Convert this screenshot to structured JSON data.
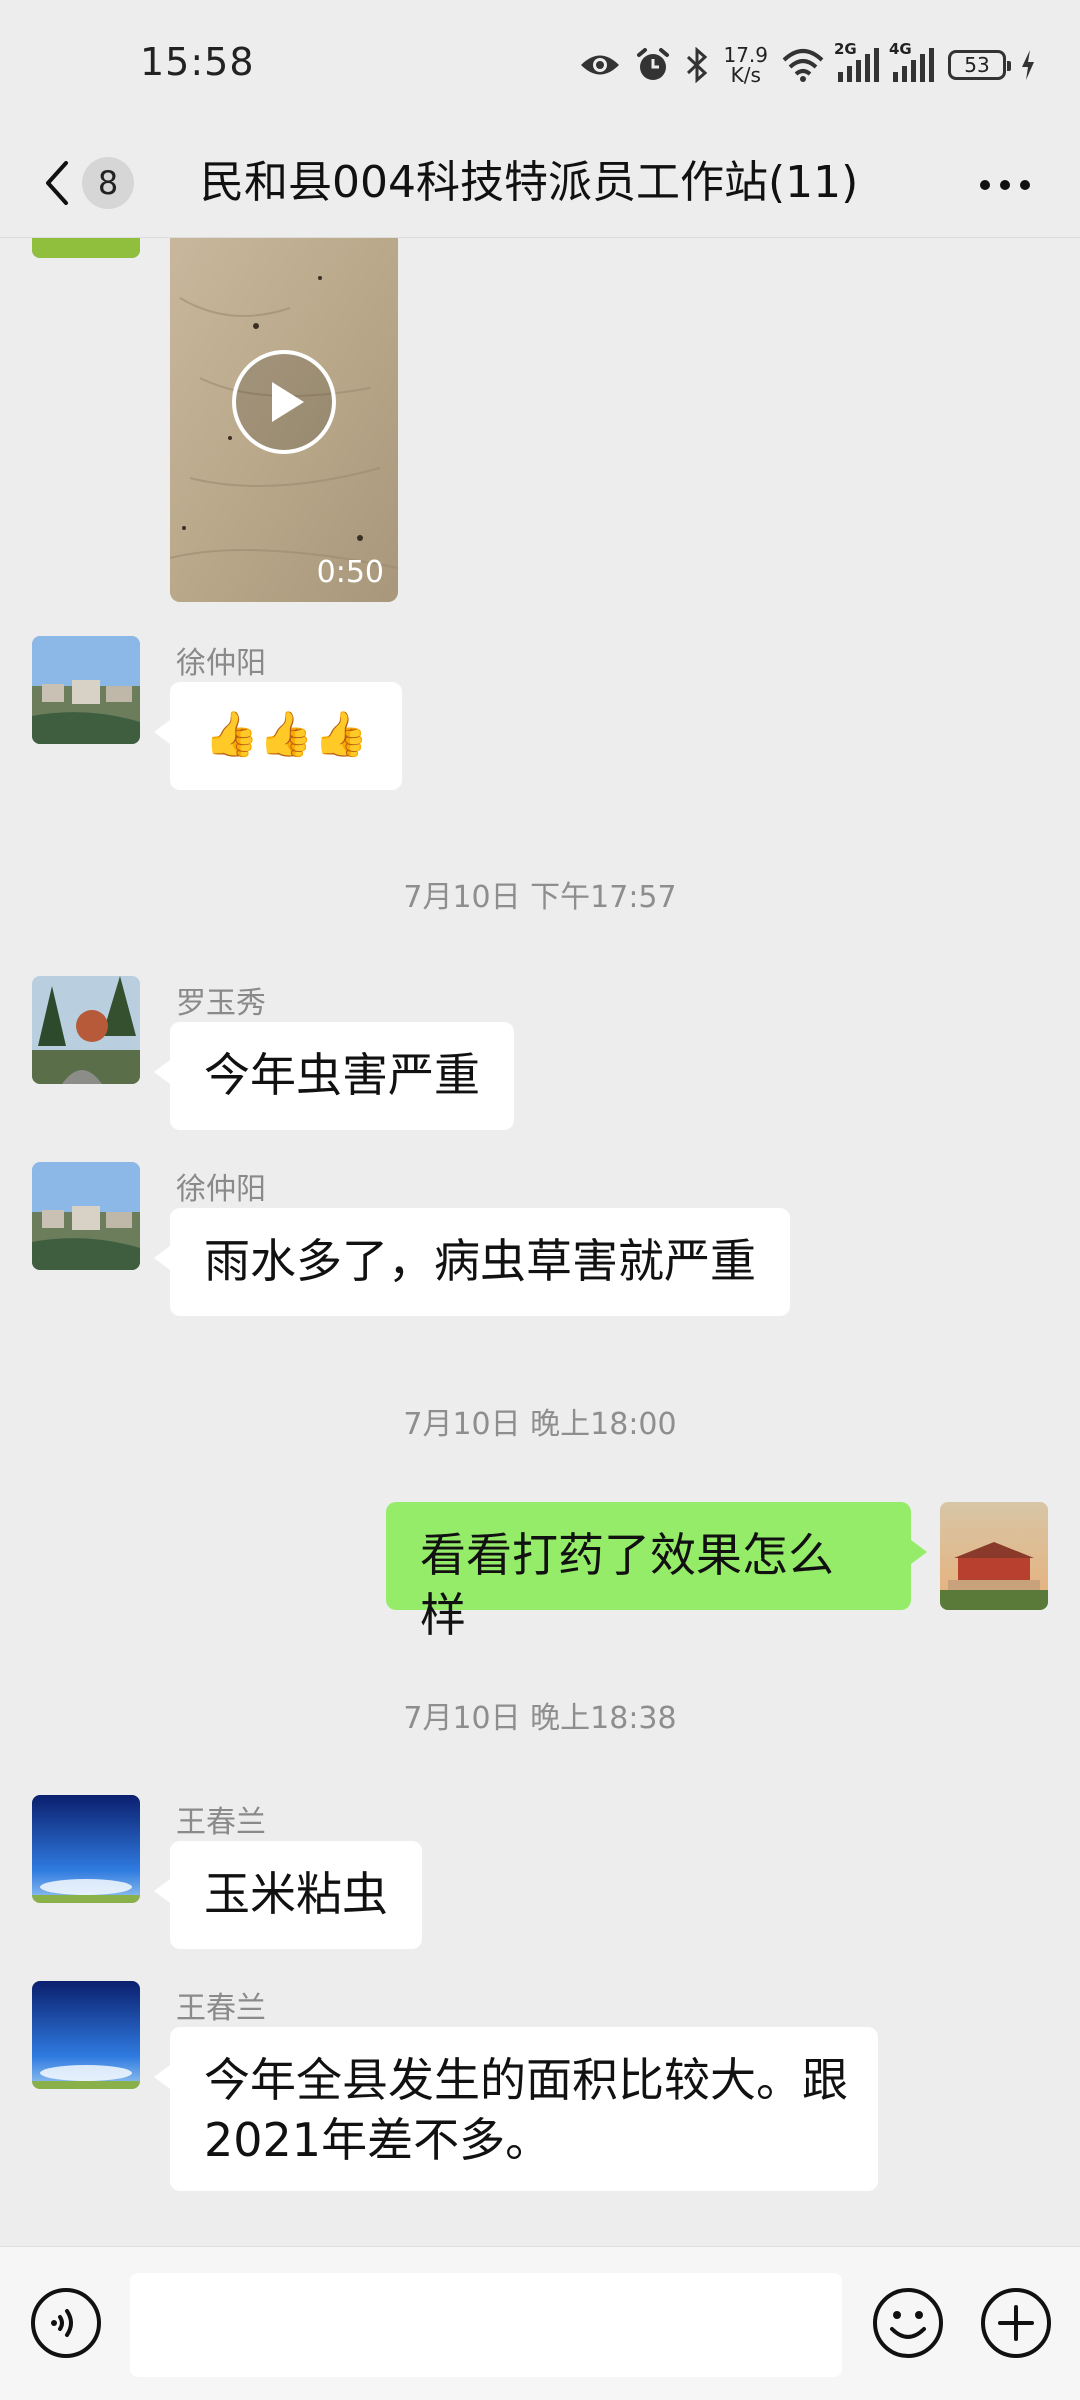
{
  "status_bar": {
    "time": "15:58",
    "speed_value": "17.9",
    "speed_unit": "K/s",
    "net1": "2G",
    "net2": "4G",
    "battery": "53"
  },
  "header": {
    "unread_count": "8",
    "title": "民和县004科技特派员工作站(11)"
  },
  "messages": {
    "video_duration": "0:50",
    "msg1": {
      "sender": "徐仲阳",
      "text": "👍👍👍"
    },
    "time1": "7月10日 下午17:57",
    "msg2": {
      "sender": "罗玉秀",
      "text": "今年虫害严重"
    },
    "msg3": {
      "sender": "徐仲阳",
      "text": "雨水多了，病虫草害就严重"
    },
    "time2": "7月10日 晚上18:00",
    "msg4": {
      "text": "看看打药了效果怎么样"
    },
    "time3": "7月10日 晚上18:38",
    "msg5": {
      "sender": "王春兰",
      "text": "玉米粘虫"
    },
    "msg6": {
      "sender": "王春兰",
      "text": "今年全县发生的面积比较大。跟2021年差不多。"
    }
  },
  "colors": {
    "background": "#ededed",
    "self_bubble": "#95ec69",
    "other_bubble": "#ffffff"
  }
}
